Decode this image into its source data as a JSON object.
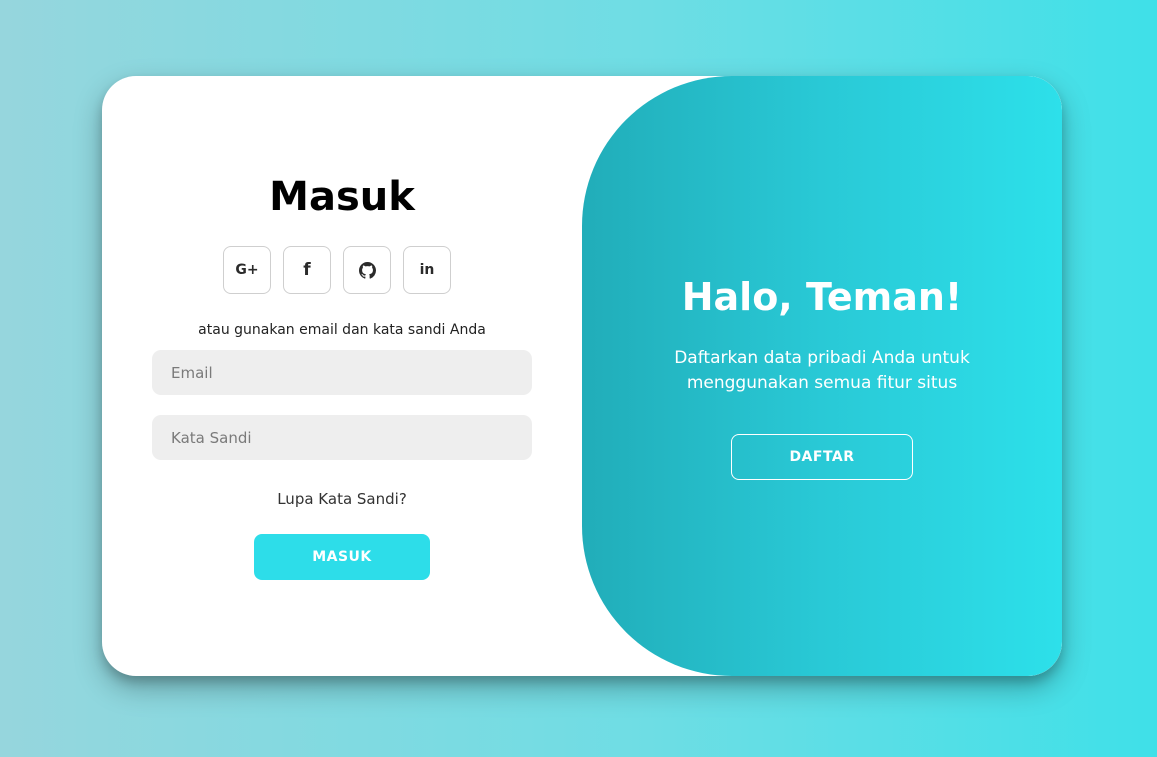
{
  "signin": {
    "title": "Masuk",
    "social": [
      {
        "icon": "google-plus-icon",
        "glyph": "G+"
      },
      {
        "icon": "facebook-icon",
        "glyph": "f"
      },
      {
        "icon": "github-icon",
        "glyph": ""
      },
      {
        "icon": "linkedin-icon",
        "glyph": "in"
      }
    ],
    "alt_text": "atau gunakan email dan kata sandi Anda",
    "email_placeholder": "Email",
    "email_value": "",
    "password_placeholder": "Kata Sandi",
    "password_value": "",
    "forgot_label": "Lupa Kata Sandi?",
    "submit_label": "MASUK"
  },
  "panel": {
    "title": "Halo, Teman!",
    "text": "Daftarkan data pribadi Anda untuk menggunakan semua fitur situs",
    "button_label": "DAFTAR"
  },
  "colors": {
    "accent": "#2ddde9",
    "panel_gradient_start": "#21adb9",
    "panel_gradient_end": "#2de0ea",
    "input_bg": "#eeeeee"
  }
}
